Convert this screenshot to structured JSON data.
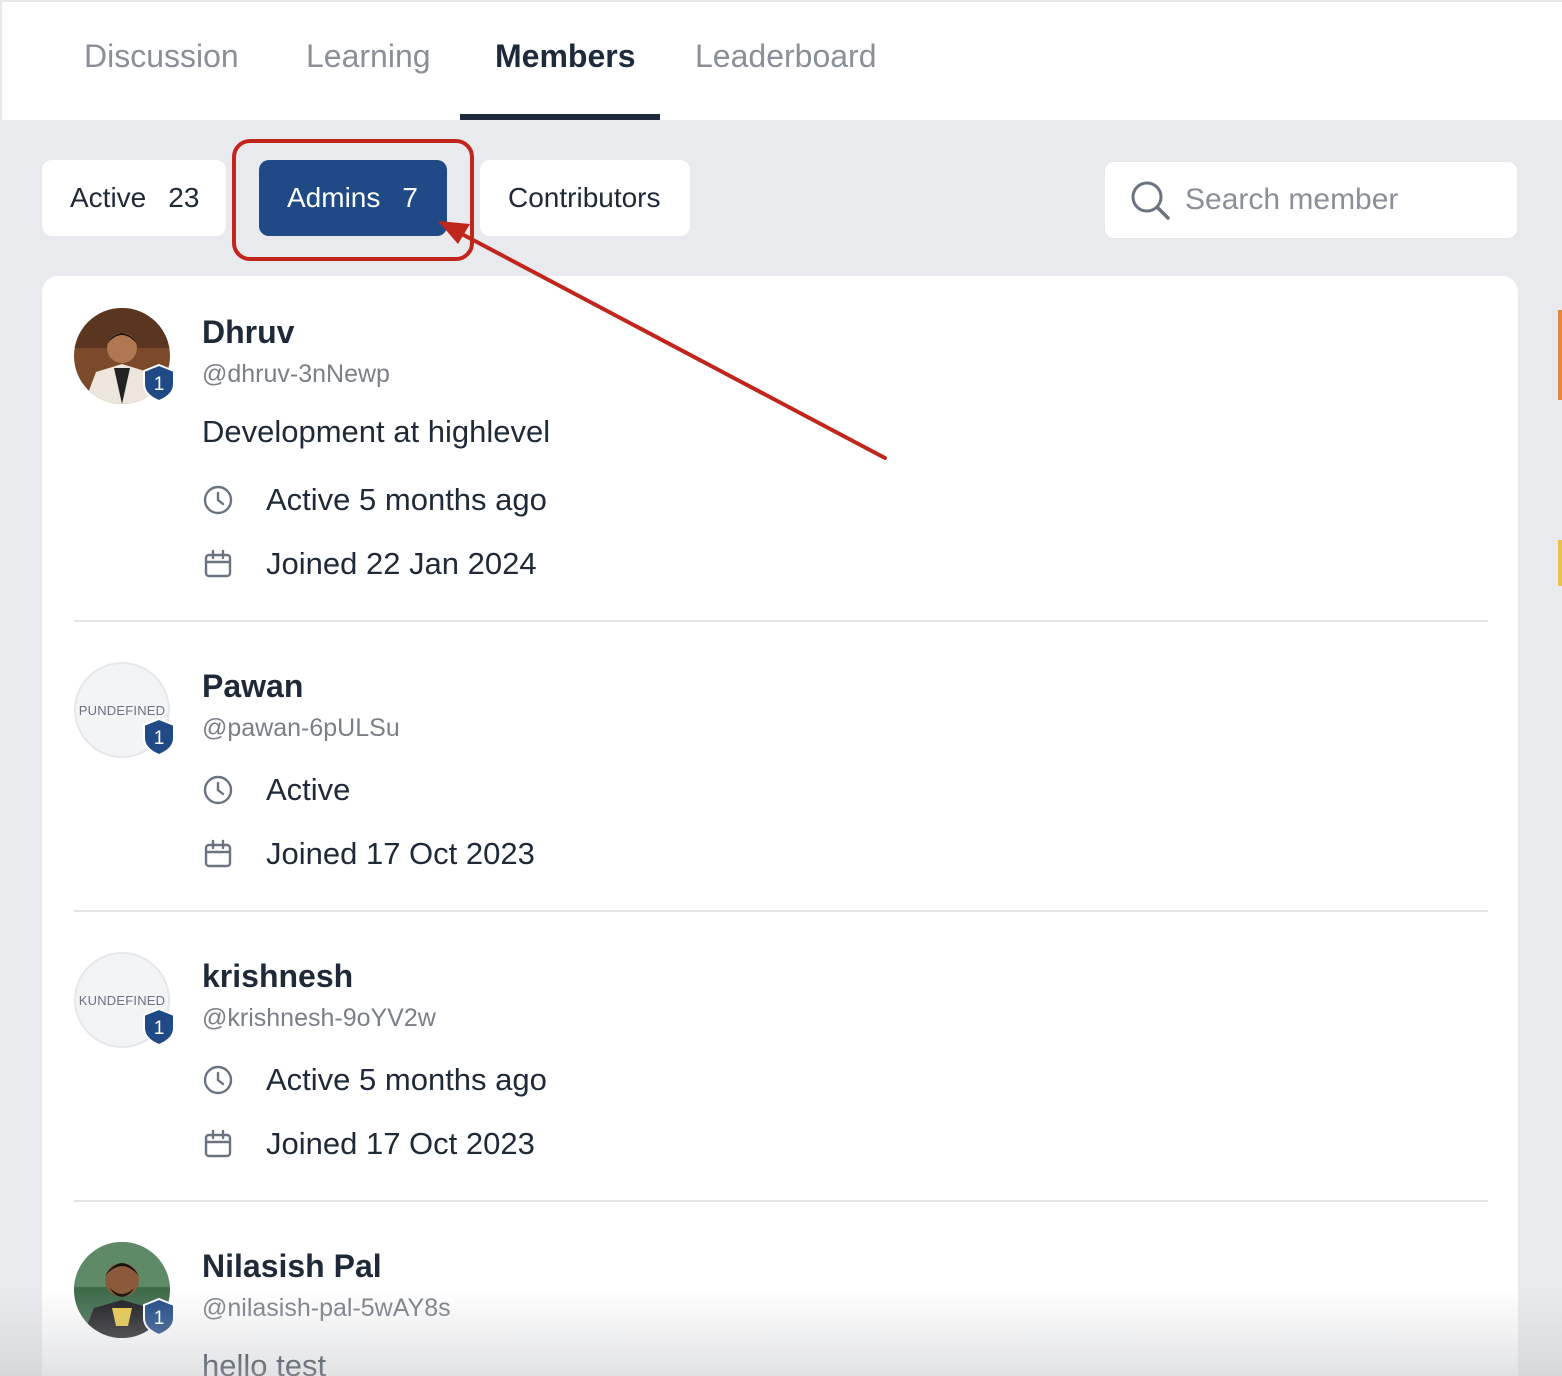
{
  "tabs": [
    {
      "label": "Discussion"
    },
    {
      "label": "Learning"
    },
    {
      "label": "Members"
    },
    {
      "label": "Leaderboard"
    }
  ],
  "filters": {
    "active": {
      "label": "Active",
      "count": "23"
    },
    "admins": {
      "label": "Admins",
      "count": "7"
    },
    "contributors": {
      "label": "Contributors"
    }
  },
  "search": {
    "placeholder": "Search member"
  },
  "members": [
    {
      "name": "Dhruv",
      "handle": "@dhruv-3nNewp",
      "bio": "Development at highlevel",
      "last_active": "Active 5 months ago",
      "joined": "Joined 22 Jan 2024",
      "level": "1"
    },
    {
      "name": "Pawan",
      "handle": "@pawan-6pULSu",
      "avatar_text": "PUNDEFINED",
      "last_active": "Active",
      "joined": "Joined 17 Oct 2023",
      "level": "1"
    },
    {
      "name": "krishnesh",
      "handle": "@krishnesh-9oYV2w",
      "avatar_text": "KUNDEFINED",
      "last_active": "Active 5 months ago",
      "joined": "Joined 17 Oct 2023",
      "level": "1"
    },
    {
      "name": "Nilasish Pal",
      "handle": "@nilasish-pal-5wAY8s",
      "bio": "hello test",
      "level": "1"
    }
  ],
  "colors": {
    "accent": "#1f4a86",
    "annotation": "#c0261b",
    "badge": "#1f4a86"
  }
}
